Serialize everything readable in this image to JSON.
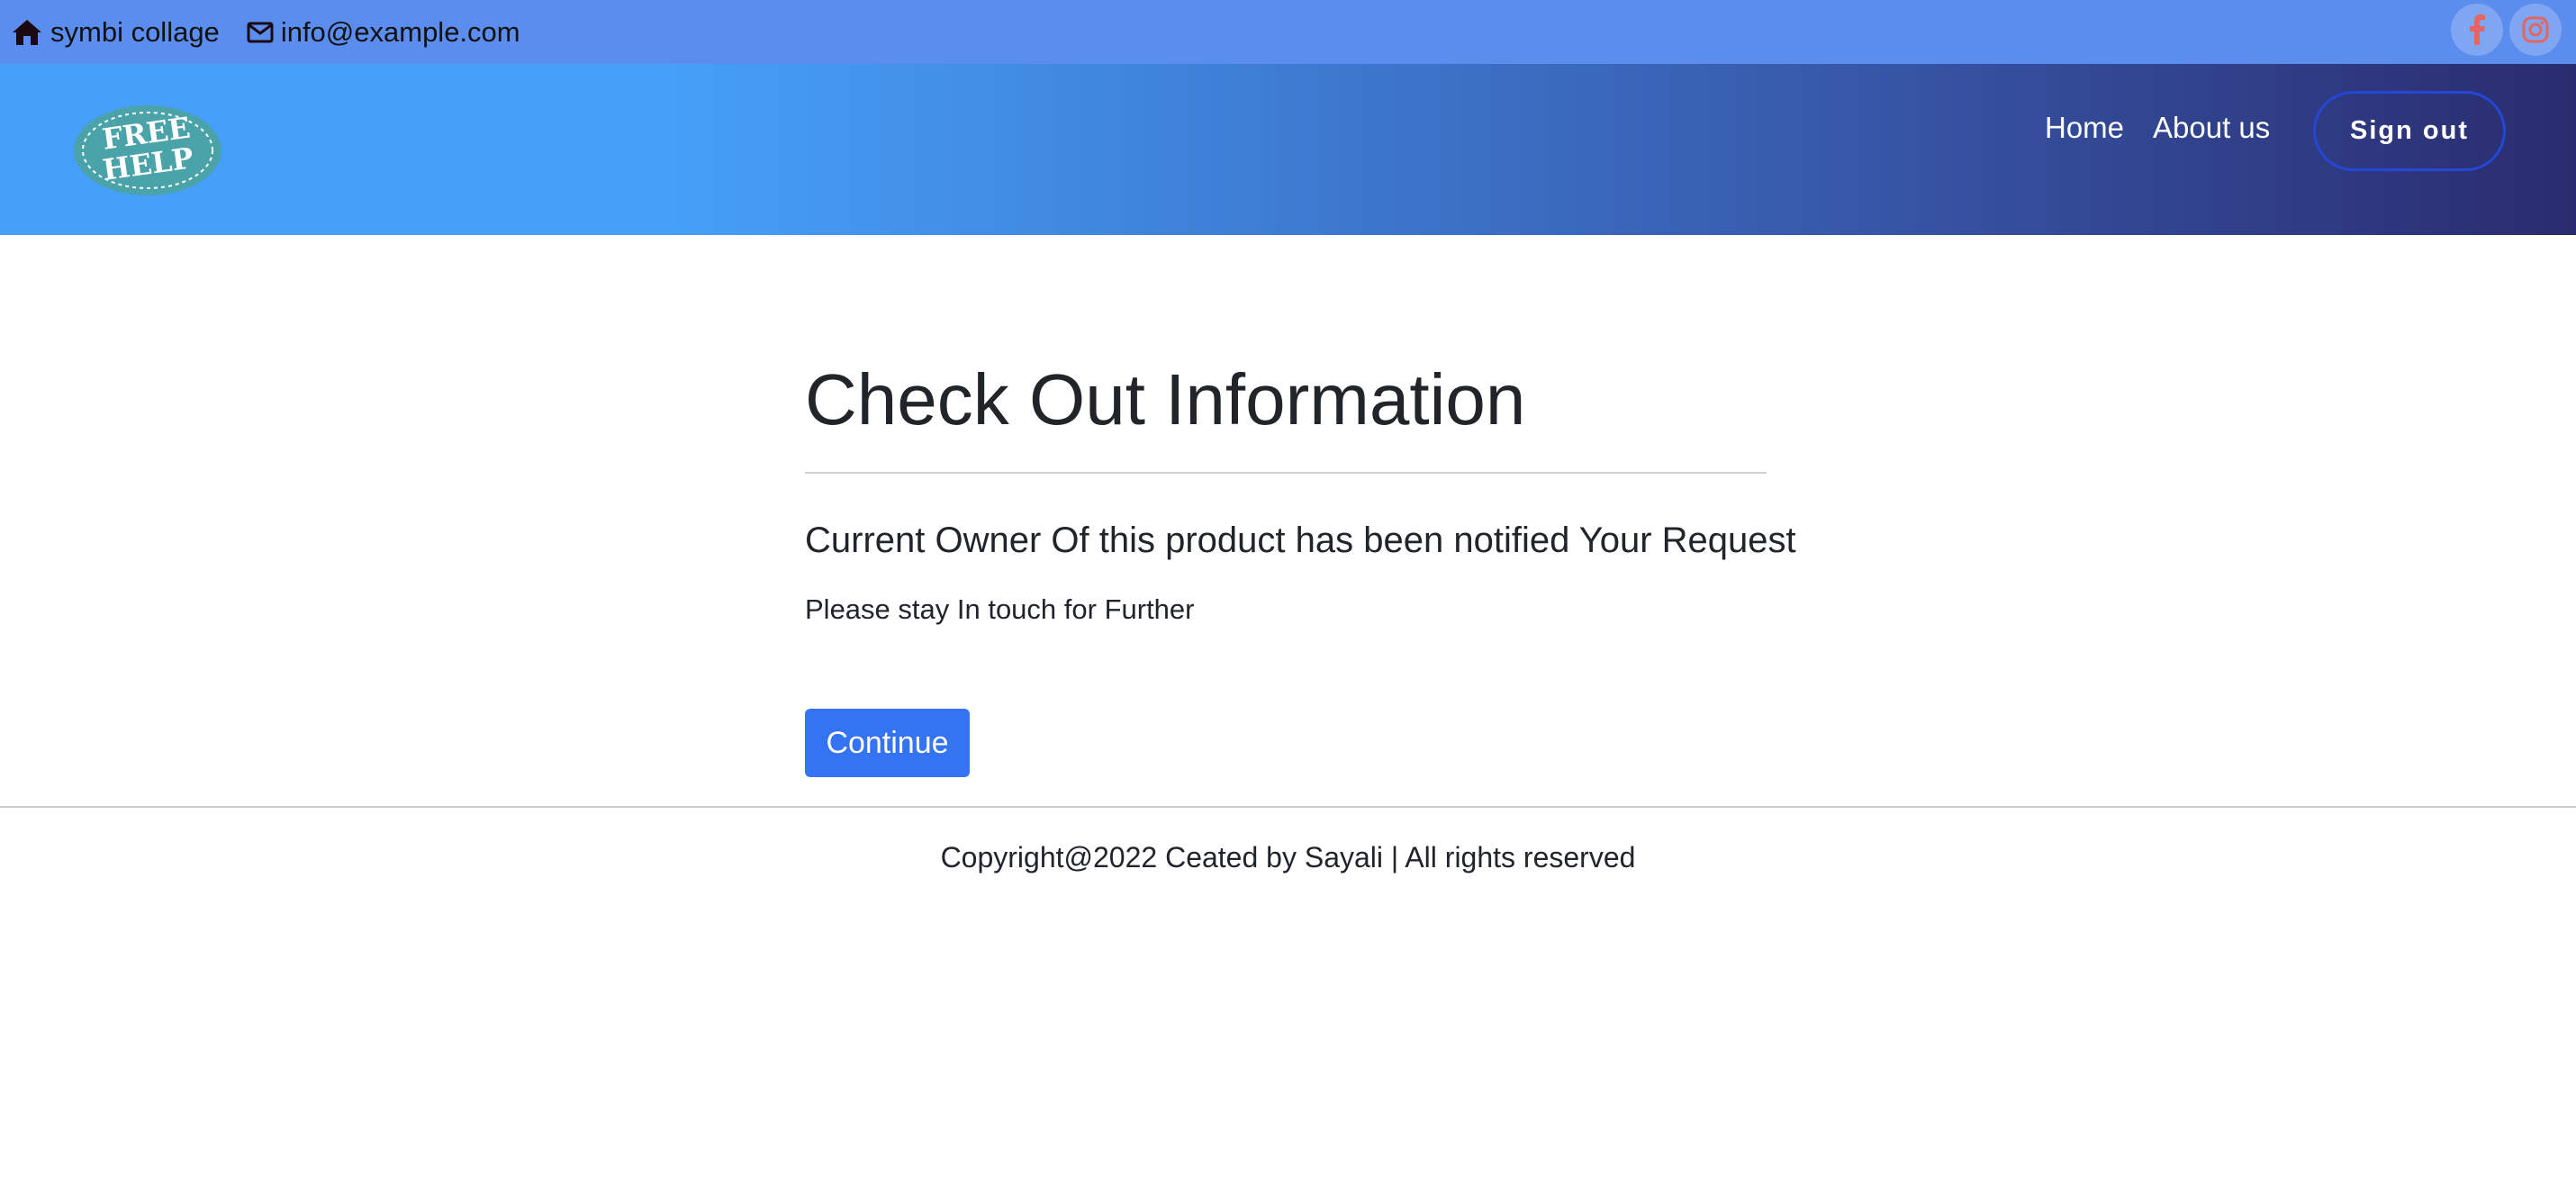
{
  "topbar": {
    "address": "symbi collage",
    "address_icon": "home-icon",
    "email": "info@example.com",
    "email_icon": "envelope-icon",
    "social": [
      "facebook-icon",
      "instagram-icon"
    ]
  },
  "header": {
    "logo_text": [
      "FREE",
      "HELP"
    ],
    "nav": {
      "home": "Home",
      "about": "About us"
    },
    "signout_label": "Sign out"
  },
  "main": {
    "title": "Check Out Information",
    "subtitle": "Current Owner Of this product has been notified Your Request",
    "note": "Please stay In touch for Further",
    "continue_label": "Continue"
  },
  "footer": {
    "text": "Copyright@2022 Ceated by Sayali | All rights reserved"
  },
  "colors": {
    "topbar_bg": "#5b8def",
    "header_gradient_start": "#469ff8",
    "header_gradient_end": "#2a2b6e",
    "button_primary": "#3473f1",
    "signout_border": "#2447d6",
    "logo_badge": "#4aa3a8"
  }
}
